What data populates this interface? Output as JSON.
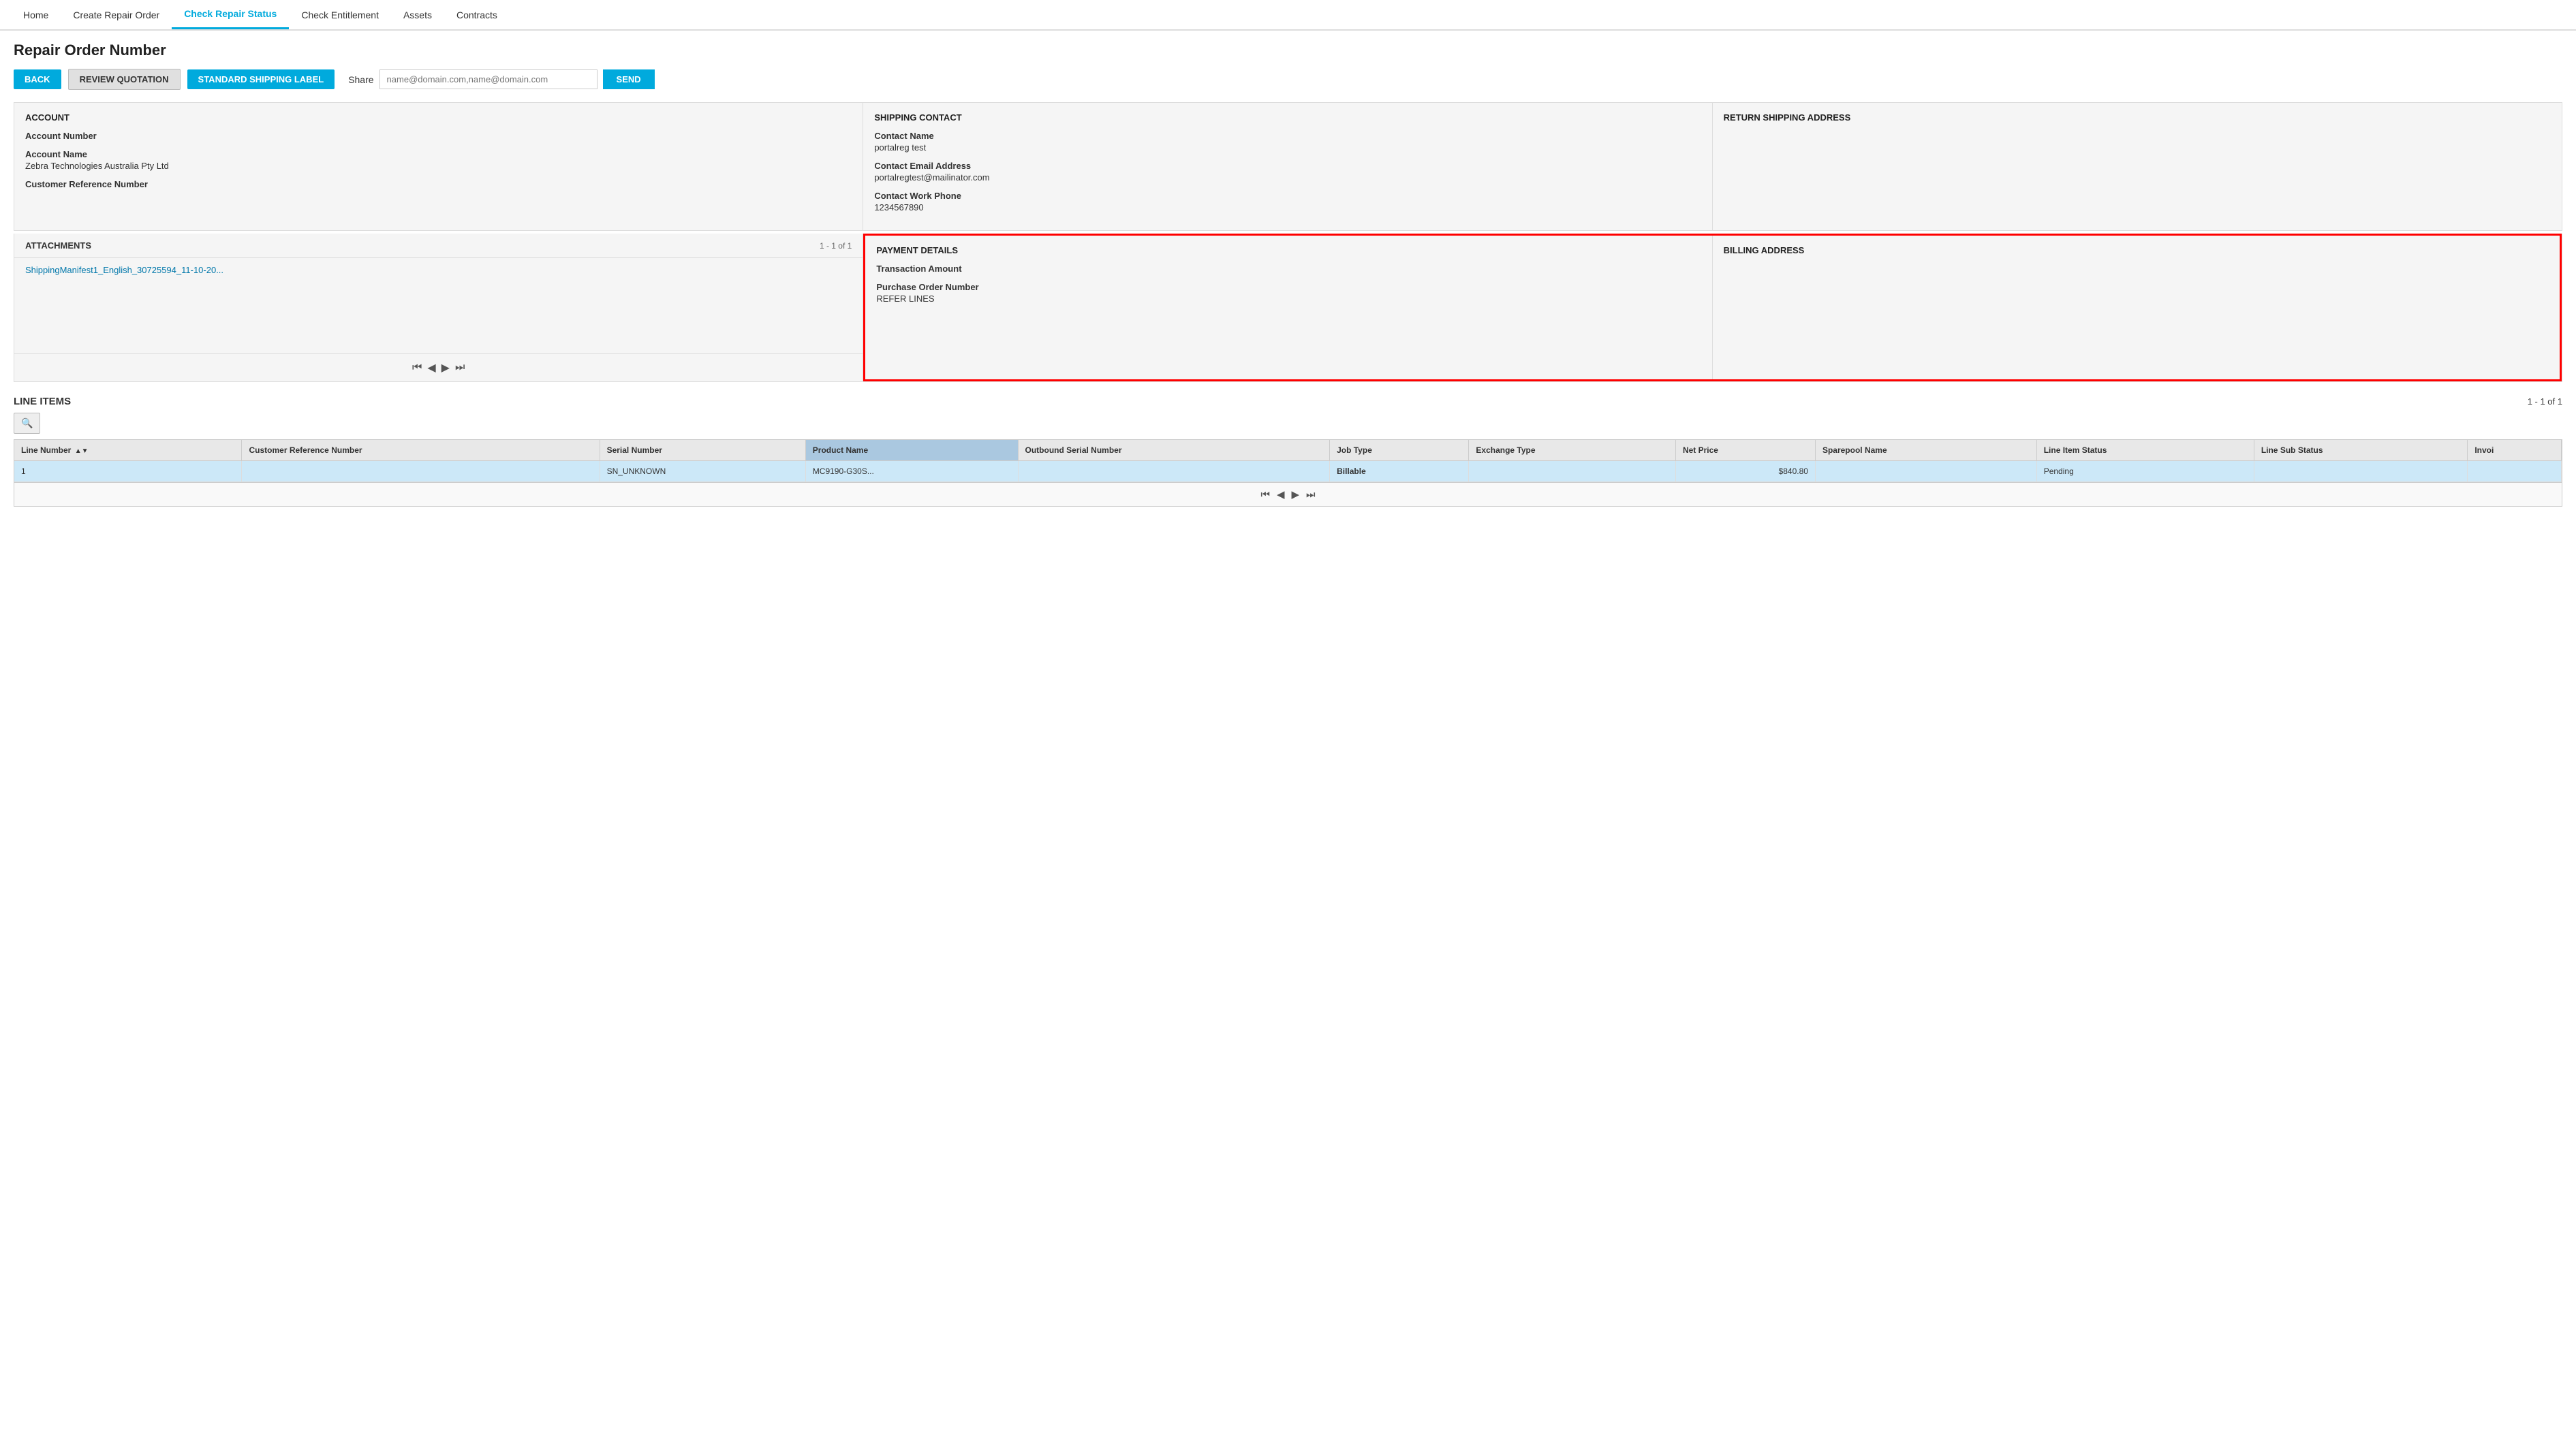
{
  "nav": {
    "items": [
      {
        "id": "home",
        "label": "Home",
        "active": false
      },
      {
        "id": "create-repair-order",
        "label": "Create Repair Order",
        "active": false
      },
      {
        "id": "check-repair-status",
        "label": "Check Repair Status",
        "active": true
      },
      {
        "id": "check-entitlement",
        "label": "Check Entitlement",
        "active": false
      },
      {
        "id": "assets",
        "label": "Assets",
        "active": false
      },
      {
        "id": "contracts",
        "label": "Contracts",
        "active": false
      }
    ]
  },
  "page": {
    "title": "Repair Order Number"
  },
  "toolbar": {
    "back_label": "BACK",
    "review_label": "REVIEW QUOTATION",
    "shipping_label": "STANDARD SHIPPING LABEL",
    "share_label": "Share",
    "share_placeholder": "name@domain.com,name@domain.com",
    "send_label": "SEND"
  },
  "account": {
    "title": "ACCOUNT",
    "fields": [
      {
        "label": "Account Number",
        "value": ""
      },
      {
        "label": "Account Name",
        "value": "Zebra Technologies Australia Pty Ltd"
      },
      {
        "label": "Customer Reference Number",
        "value": ""
      }
    ]
  },
  "shipping_contact": {
    "title": "SHIPPING CONTACT",
    "fields": [
      {
        "label": "Contact Name",
        "value": "portalreg test"
      },
      {
        "label": "Contact Email Address",
        "value": "portalregtest@mailinator.com"
      },
      {
        "label": "Contact Work Phone",
        "value": "1234567890"
      }
    ]
  },
  "return_shipping": {
    "title": "RETURN SHIPPING ADDRESS",
    "fields": []
  },
  "attachments": {
    "title": "ATTACHMENTS",
    "count": "1 - 1 of 1",
    "items": [
      {
        "name": "ShippingManifest1_English_30725594_11-10-20..."
      }
    ],
    "pagination": {
      "first": "⏮",
      "prev": "◀",
      "next": "▶",
      "last": "⏭"
    }
  },
  "payment": {
    "title": "PAYMENT DETAILS",
    "fields": [
      {
        "label": "Transaction Amount",
        "value": ""
      },
      {
        "label": "Purchase Order Number",
        "value": "REFER LINES"
      }
    ]
  },
  "billing": {
    "title": "BILLING ADDRESS",
    "fields": []
  },
  "line_items": {
    "title": "LINE ITEMS",
    "count": "1 - 1 of 1",
    "columns": [
      {
        "id": "line-number",
        "label": "Line Number",
        "highlighted": false,
        "sortable": true
      },
      {
        "id": "customer-ref",
        "label": "Customer Reference Number",
        "highlighted": false,
        "sortable": false
      },
      {
        "id": "serial-number",
        "label": "Serial Number",
        "highlighted": false,
        "sortable": false
      },
      {
        "id": "product-name",
        "label": "Product Name",
        "highlighted": true,
        "sortable": false
      },
      {
        "id": "outbound-serial",
        "label": "Outbound Serial Number",
        "highlighted": false,
        "sortable": false
      },
      {
        "id": "job-type",
        "label": "Job Type",
        "highlighted": false,
        "sortable": false
      },
      {
        "id": "exchange-type",
        "label": "Exchange Type",
        "highlighted": false,
        "sortable": false
      },
      {
        "id": "net-price",
        "label": "Net Price",
        "highlighted": false,
        "sortable": false
      },
      {
        "id": "sparepool-name",
        "label": "Sparepool Name",
        "highlighted": false,
        "sortable": false
      },
      {
        "id": "line-item-status",
        "label": "Line Item Status",
        "highlighted": false,
        "sortable": false
      },
      {
        "id": "line-sub-status",
        "label": "Line Sub Status",
        "highlighted": false,
        "sortable": false
      },
      {
        "id": "invoice",
        "label": "Invoi",
        "highlighted": false,
        "sortable": false
      }
    ],
    "rows": [
      {
        "line_number": "1",
        "customer_ref": "",
        "serial_number": "SN_UNKNOWN",
        "product_name": "MC9190-G30S...",
        "outbound_serial": "",
        "job_type": "Billable",
        "exchange_type": "",
        "net_price": "$840.80",
        "sparepool_name": "",
        "line_item_status": "Pending",
        "line_sub_status": "",
        "invoice": ""
      }
    ]
  }
}
